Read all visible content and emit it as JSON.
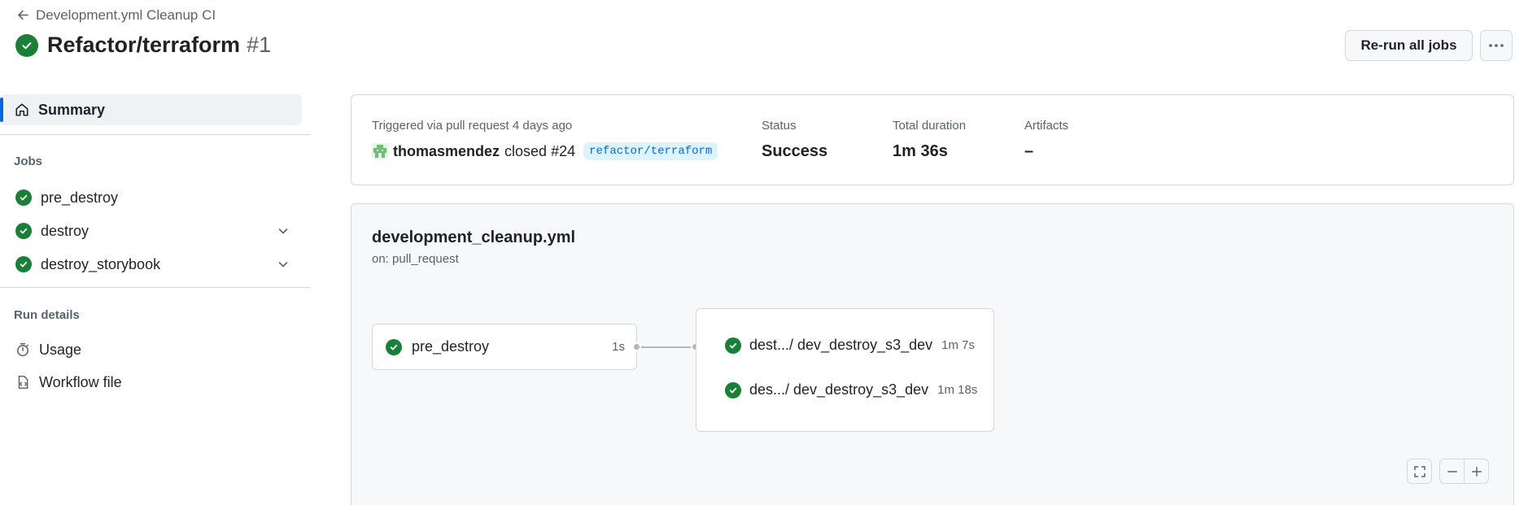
{
  "header": {
    "back_label": "Development.yml Cleanup CI",
    "title": "Refactor/terraform",
    "run_number": "#1",
    "rerun_label": "Re-run all jobs"
  },
  "sidebar": {
    "summary_label": "Summary",
    "jobs_heading": "Jobs",
    "jobs": [
      {
        "label": "pre_destroy",
        "status": "success"
      },
      {
        "label": "destroy",
        "status": "success",
        "expandable": true
      },
      {
        "label": "destroy_storybook",
        "status": "success",
        "expandable": true
      }
    ],
    "run_details_heading": "Run details",
    "details": [
      {
        "label": "Usage",
        "icon": "stopwatch-icon"
      },
      {
        "label": "Workflow file",
        "icon": "file-code-icon"
      }
    ]
  },
  "summary": {
    "trigger_label": "Triggered via pull request 4 days ago",
    "user": "thomasmendez",
    "action": "closed #24",
    "branch": "refactor/terraform",
    "status_label": "Status",
    "status_value": "Success",
    "duration_label": "Total duration",
    "duration_value": "1m 36s",
    "artifacts_label": "Artifacts",
    "artifacts_value": "–"
  },
  "workflow": {
    "file": "development_cleanup.yml",
    "trigger": "on: pull_request",
    "first_job": {
      "label": "pre_destroy",
      "duration": "1s"
    },
    "group_jobs": [
      {
        "label": "dest.../ dev_destroy_s3_dev",
        "duration": "1m 7s"
      },
      {
        "label": "des.../ dev_destroy_s3_dev",
        "duration": "1m 18s"
      }
    ]
  },
  "colors": {
    "success": "#1a7f37",
    "accent": "#0969da",
    "muted": "#59636e",
    "border": "#d1d9e0"
  }
}
